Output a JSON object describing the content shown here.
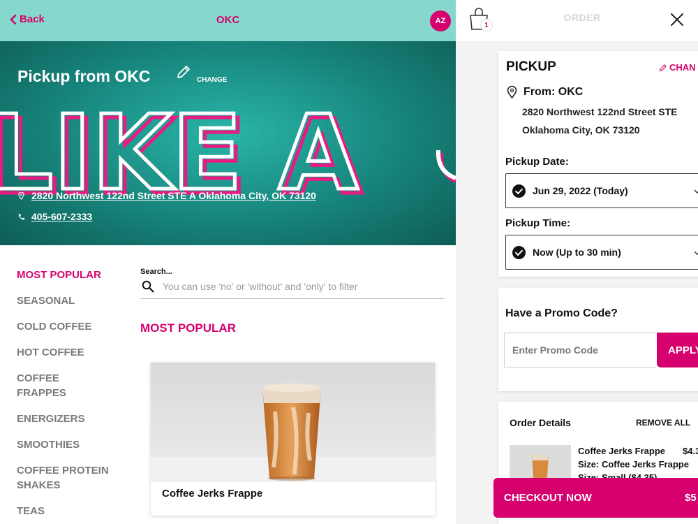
{
  "header": {
    "back_label": "Back",
    "store_name": "OKC",
    "avatar_initials": "AZ"
  },
  "hero": {
    "title": "Pickup from OKC",
    "change_label": "CHANGE",
    "background_text": "LIKE A",
    "address": "2820 Northwest 122nd Street STE A Oklahoma City, OK 73120",
    "phone": "405-607-2333"
  },
  "categories": [
    {
      "label": "MOST POPULAR",
      "active": true
    },
    {
      "label": "SEASONAL"
    },
    {
      "label": "COLD COFFEE"
    },
    {
      "label": "HOT COFFEE"
    },
    {
      "label": "COFFEE FRAPPES"
    },
    {
      "label": "ENERGIZERS"
    },
    {
      "label": "SMOOTHIES"
    },
    {
      "label": "COFFEE PROTEIN SHAKES"
    },
    {
      "label": "TEAS"
    }
  ],
  "search": {
    "label": "Search...",
    "placeholder": "You can use 'no' or 'without' and 'only' to filter"
  },
  "section": {
    "title": "MOST POPULAR"
  },
  "products": [
    {
      "name": "Coffee Jerks Frappe"
    }
  ],
  "cart": {
    "bag_count": "1",
    "title": "ORDER",
    "pickup_heading": "PICKUP",
    "change_label": "CHAN",
    "from_label": "From: OKC",
    "address_line1": "2820 Northwest 122nd Street STE",
    "address_line2": "Oklahoma City, OK 73120",
    "pickup_date_label": "Pickup Date:",
    "pickup_date_value": "Jun 29, 2022 (Today)",
    "pickup_time_label": "Pickup Time:",
    "pickup_time_value": "Now (Up to 30 min)",
    "promo_heading": "Have a Promo Code?",
    "promo_placeholder": "Enter Promo Code",
    "apply_label": "APPLY",
    "order_details_label": "Order Details",
    "remove_all_label": "REMOVE ALL",
    "item": {
      "name": "Coffee Jerks Frappe",
      "price": "$4.3",
      "size": "Size: Coffee Jerks Frappe",
      "size_detail": "Size: Small ($4.35)"
    },
    "checkout_label": "CHECKOUT NOW",
    "checkout_total": "$5"
  },
  "colors": {
    "brand": "#d6006f",
    "header_teal": "#86d8cc",
    "hero_teal": "#17857c"
  }
}
